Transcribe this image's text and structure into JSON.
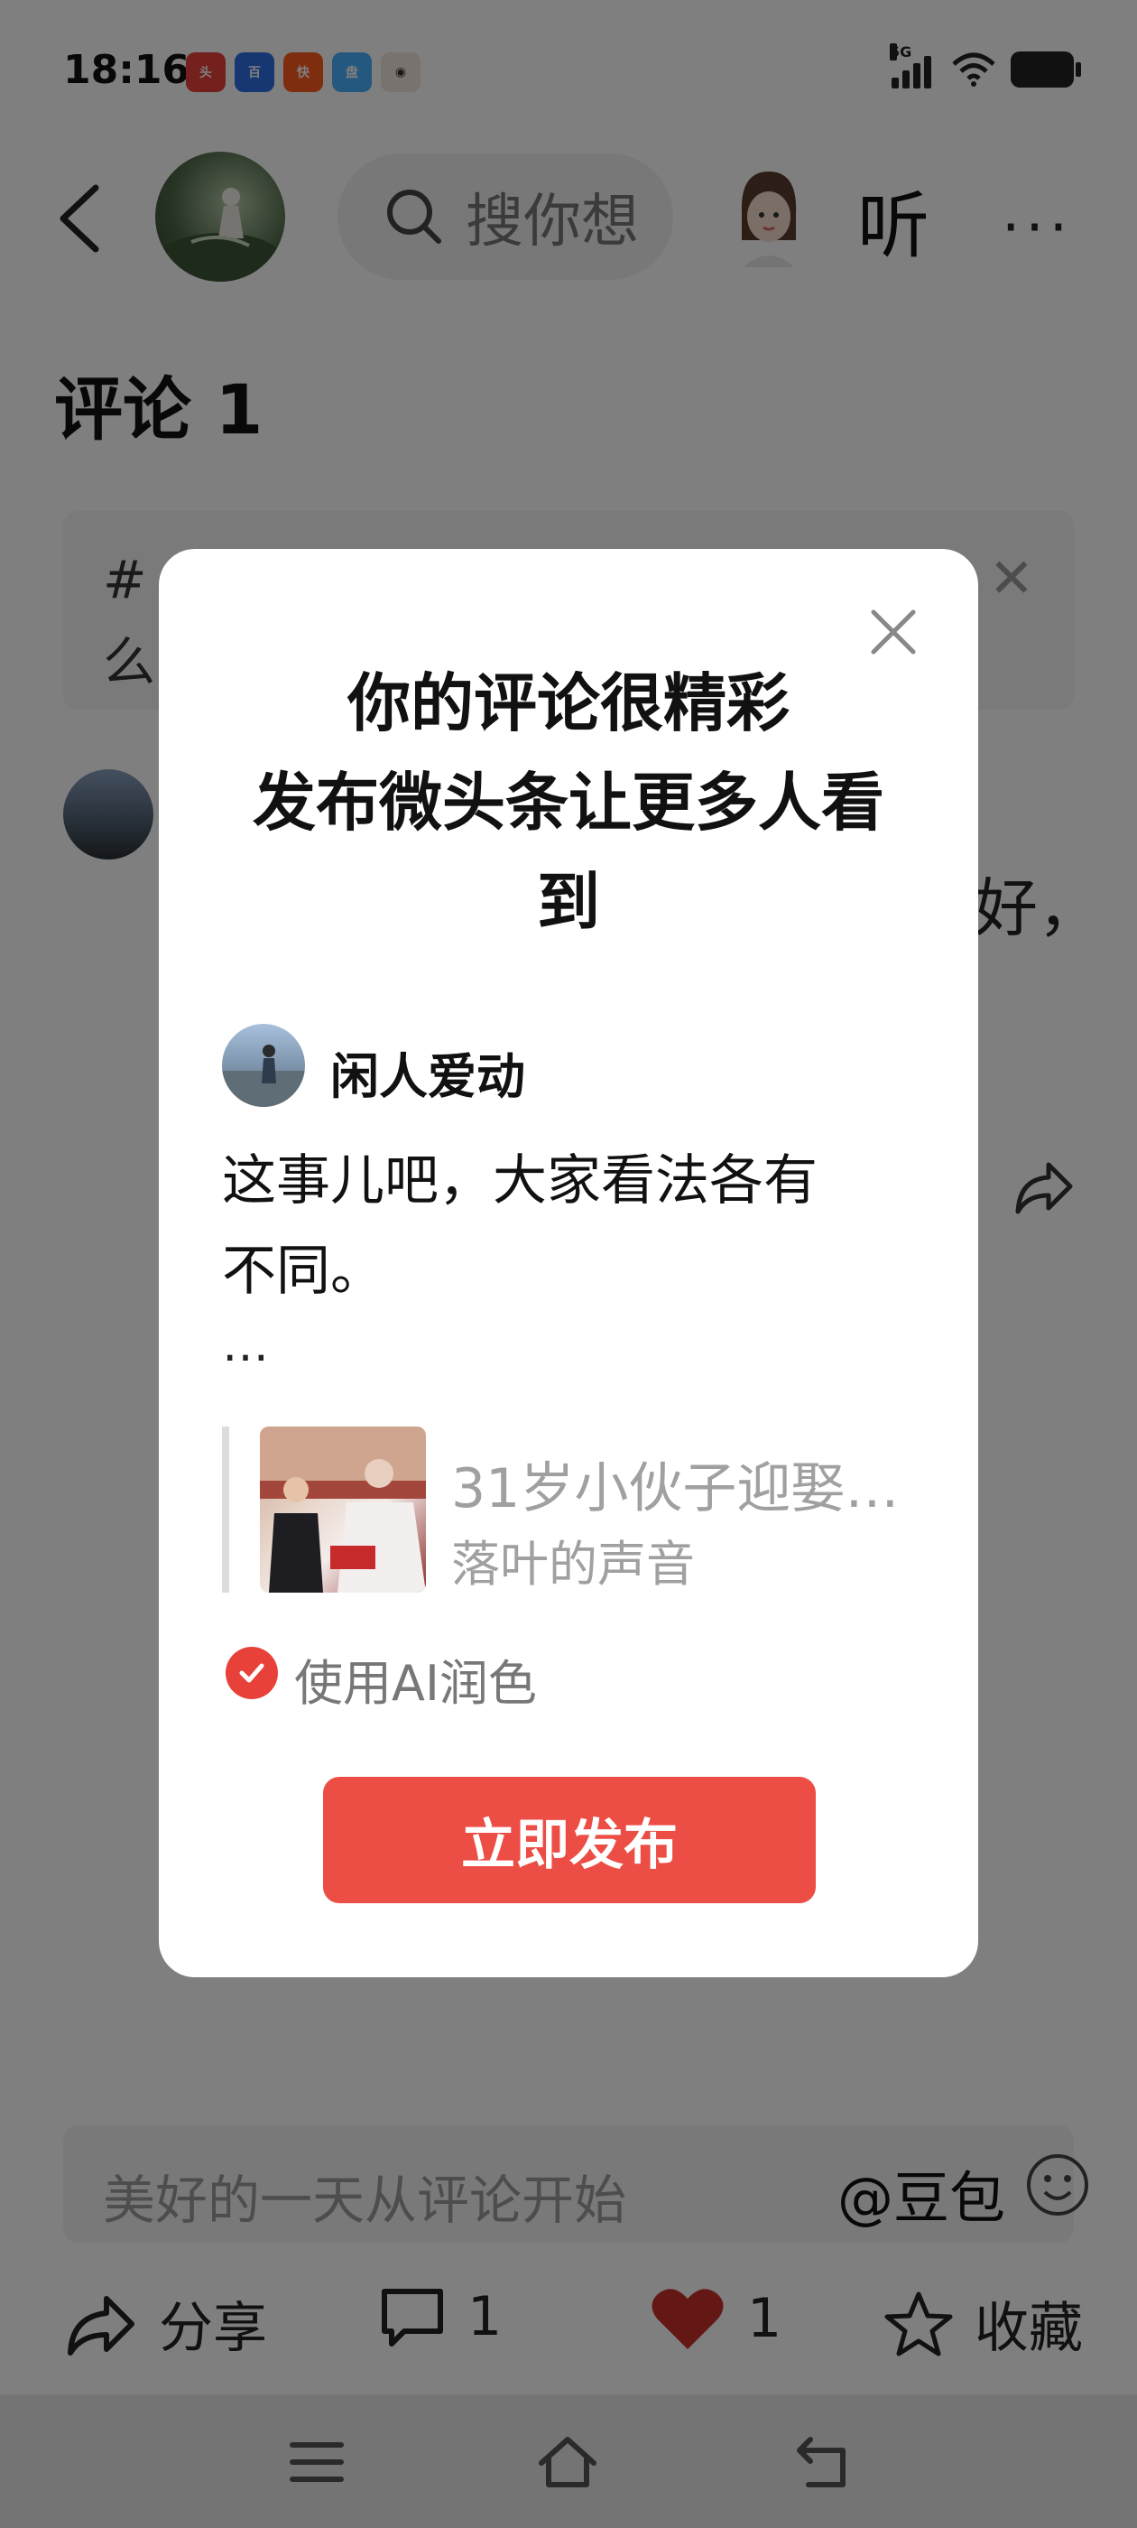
{
  "status_bar": {
    "time": "18:16",
    "app_icons": [
      "toutiao-app-icon",
      "baidu-app-icon",
      "kuaishou-app-icon",
      "pan-app-icon",
      "avatar-app-icon"
    ],
    "network": "5G"
  },
  "header": {
    "search_placeholder": "搜你想",
    "listen_label": "听",
    "more_label": "···"
  },
  "comments": {
    "title": "评论 1",
    "topic_icon": "#",
    "topic_text": "么",
    "comment_tail": "好，"
  },
  "bottom": {
    "input_placeholder": "美好的一天从评论开始",
    "mention": "@豆包",
    "share_label": "分享",
    "comment_count": "1",
    "like_count": "1",
    "favorite_label": "收藏"
  },
  "modal": {
    "title_line1": "你的评论很精彩",
    "title_line2": "发布微头条让更多人看",
    "title_line3": "到",
    "author_name": "闲人爱动",
    "comment_line1": "这事儿吧，大家看法各有",
    "comment_line2": "不同。",
    "ellipsis": "…",
    "article_title": "31岁小伙子迎娶…",
    "article_source": "落叶的声音",
    "ai_polish_label": "使用AI润色",
    "ai_polish_checked": true,
    "publish_button": "立即发布"
  },
  "colors": {
    "accent": "#ec4d44",
    "like_heart": "#c9302c",
    "check": "#e8413a"
  }
}
